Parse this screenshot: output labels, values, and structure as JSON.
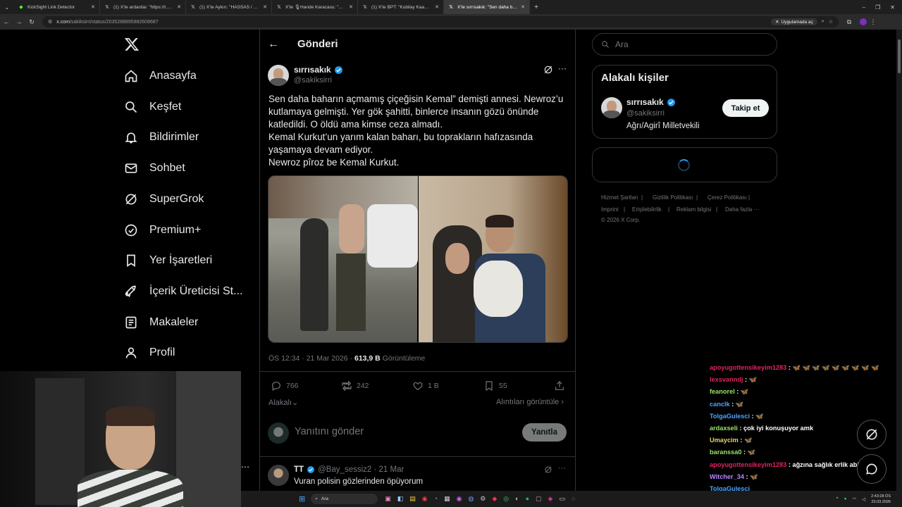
{
  "browser": {
    "tabs": [
      {
        "title": "KickSight Link Detector",
        "icon": "kick-icon",
        "active": false
      },
      {
        "title": "(1) X'te ardardaı: \"https://t.co/...",
        "icon": "x-icon",
        "active": false
      },
      {
        "title": "(1) X'te Aykırı: \"HASSAS / Şoke...",
        "icon": "x-icon",
        "active": false
      },
      {
        "title": "X'te 🎙Hande Karacasu: \"Vahşi...",
        "icon": "x-icon",
        "active": false
      },
      {
        "title": "(1) X'te BPT: \"Kubilay Kaan Kurt...",
        "icon": "x-icon",
        "active": false
      },
      {
        "title": "X'te sırrısakık: \"Sen daha bahar...",
        "icon": "x-icon",
        "active": true
      }
    ],
    "url_host": "x.com",
    "url_path": "/sakiksirri/status/2035288895982608687",
    "app_button": "Uygulamada aç"
  },
  "sidebar": {
    "items": [
      {
        "label": "Anasayfa",
        "icon": "home-icon"
      },
      {
        "label": "Keşfet",
        "icon": "search-icon"
      },
      {
        "label": "Bildirimler",
        "icon": "bell-icon"
      },
      {
        "label": "Sohbet",
        "icon": "mail-icon"
      },
      {
        "label": "SuperGrok",
        "icon": "grok-icon"
      },
      {
        "label": "Premium+",
        "icon": "verified-badge-icon"
      },
      {
        "label": "Yer İşaretleri",
        "icon": "bookmark-icon"
      },
      {
        "label": "İçerik Üreticisi St...",
        "icon": "rocket-icon"
      },
      {
        "label": "Makaleler",
        "icon": "article-icon"
      },
      {
        "label": "Profil",
        "icon": "person-icon"
      }
    ],
    "more": "…"
  },
  "post": {
    "header_title": "Gönderi",
    "author_name": "sırrısakık",
    "author_handle": "@sakiksirri",
    "text_lines": [
      "Sen daha baharın açmamış çiçeğisin Kemal” demişti annesi. Newroz’u",
      "kutlamaya gelmişti. Yer gök şahitti, binlerce insanın gözü önünde",
      "katledildi. O öldü ama kimse ceza almadı.",
      "Kemal Kurkut’un yarım kalan baharı, bu toprakların hafızasında",
      "yaşamaya devam ediyor.",
      "Newroz pîroz be Kemal Kurkut."
    ],
    "timestamp": "ÖS 12:34 · 21 Mar 2026 · ",
    "views_count": "613,9 B",
    "views_label": " Görüntüleme",
    "replies": "766",
    "reposts": "242",
    "likes": "1 B",
    "bookmarks": "55",
    "relevant_label": "Alakalı",
    "quotes_label": "Alıntıları görüntüle",
    "reply_placeholder": "Yanıtını gönder",
    "reply_button": "Yanıtla"
  },
  "reply_tweet": {
    "name": "TT",
    "handle": "@Bay_sessiz2 · 21 Mar",
    "text": "Vuran polisin gözlerinden öpüyorum"
  },
  "right": {
    "search_placeholder": "Ara",
    "related_title": "Alakalı kişiler",
    "person_name": "sırrısakık",
    "person_handle": "@sakiksirri",
    "person_bio": "Ağrı/Agirî Milletvekili",
    "follow_button": "Takip et",
    "footer_links": [
      "Hizmet Şartları",
      "|",
      "Gizlilik Politikası",
      "|",
      "Çerez Politikası",
      "|",
      "Imprint",
      "|",
      "Erişilebilirlik",
      "|",
      "Reklam bilgisi",
      "|",
      "Daha fazla ···",
      "© 2026 X Corp."
    ]
  },
  "chat": [
    {
      "user": "apoyugottensikeyim1283",
      "color": "#e0245e",
      "msg": "🦋 🦋 🦋 🦋 🦋 🦋 🦋 🦋 🦋"
    },
    {
      "user": "lexsvanndj",
      "color": "#e0245e",
      "msg": "🦋"
    },
    {
      "user": "feanorel",
      "color": "#9ae36a",
      "msg": "🦋"
    },
    {
      "user": "canclk",
      "color": "#4ea3ff",
      "msg": "🦋"
    },
    {
      "user": "TolgaGulesci",
      "color": "#4ea3ff",
      "msg": "🦋"
    },
    {
      "user": "ardaxseli",
      "color": "#9ae36a",
      "msg": "çok iyi konuşuyor amk"
    },
    {
      "user": "Umaycim",
      "color": "#e8d36a",
      "msg": "🦋"
    },
    {
      "user": "baranssa0",
      "color": "#9ae36a",
      "msg": "🦋"
    },
    {
      "user": "apoyugottensikeyim1283",
      "color": "#e0245e",
      "msg": "ağzına sağlık erlik abinin"
    },
    {
      "user": "Witcher_34",
      "color": "#b388ff",
      "msg": "🦋"
    },
    {
      "user": "TolgaGulesci",
      "color": "#4ea3ff",
      "msg": ""
    }
  ],
  "taskbar": {
    "search_placeholder": "Ara",
    "time": "2:43:28 ÖS",
    "date": "23.03.2026"
  },
  "colors": {
    "accent": "#1d9bf0",
    "verified": "#1d9bf0",
    "background": "#000000",
    "border": "#2f3336"
  }
}
